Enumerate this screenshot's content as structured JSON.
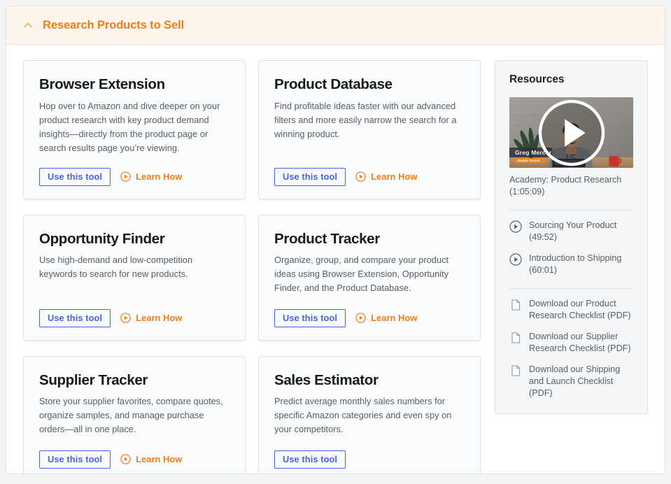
{
  "header": {
    "title": "Research Products to Sell",
    "chevron_icon": "chevron-up-icon",
    "accent_color": "#f07d18",
    "background_color": "#fdf4ec"
  },
  "ui": {
    "button_color": "#4662e8",
    "link_color": "#f07d18",
    "play_icon": "play-circle-icon",
    "document_icon": "document-icon"
  },
  "cards": [
    {
      "title": "Browser Extension",
      "description": "Hop over to Amazon and dive deeper on your product research with key product demand insights—directly from the product page or search results page you’re viewing.",
      "primary_label": "Use this tool",
      "learn_label": "Learn How",
      "has_learn": true
    },
    {
      "title": "Product Database",
      "description": "Find profitable ideas faster with our advanced filters and more easily narrow the search for a winning product.",
      "primary_label": "Use this tool",
      "learn_label": "Learn How",
      "has_learn": true
    },
    {
      "title": "Opportunity Finder",
      "description": "Use high-demand and low-competition keywords to search for new products.",
      "primary_label": "Use this tool",
      "learn_label": "Learn How",
      "has_learn": true
    },
    {
      "title": "Product Tracker",
      "description": "Organize, group, and compare your product ideas using Browser Extension, Opportunity Finder, and the Product Database.",
      "primary_label": "Use this tool",
      "learn_label": "Learn How",
      "has_learn": true
    },
    {
      "title": "Supplier Tracker",
      "description": "Store your supplier favorites, compare quotes, organize samples, and manage purchase orders—all in one place.",
      "primary_label": "Use this tool",
      "learn_label": "Learn How",
      "has_learn": true
    },
    {
      "title": "Sales Estimator",
      "description": "Predict average monthly sales numbers for specific Amazon categories and even spy on your competitors.",
      "primary_label": "Use this tool",
      "learn_label": "",
      "has_learn": false
    }
  ],
  "resources": {
    "title": "Resources",
    "video": {
      "caption": "Academy: Product Research (1:05:09)",
      "speaker_name": "Greg Mercer",
      "speaker_badge": "Jungle Scout",
      "shirt_logo": "JS"
    },
    "videos": [
      {
        "label": "Sourcing Your Product (49:52)",
        "icon": "play-circle-icon"
      },
      {
        "label": "Introduction to Shipping (60:01)",
        "icon": "play-circle-icon"
      }
    ],
    "downloads": [
      {
        "label": "Download our Product Research Checklist (PDF)",
        "icon": "document-icon"
      },
      {
        "label": "Download our Supplier Research Checklist (PDF)",
        "icon": "document-icon"
      },
      {
        "label": "Download our Shipping and Launch Checklist (PDF)",
        "icon": "document-icon"
      }
    ]
  }
}
